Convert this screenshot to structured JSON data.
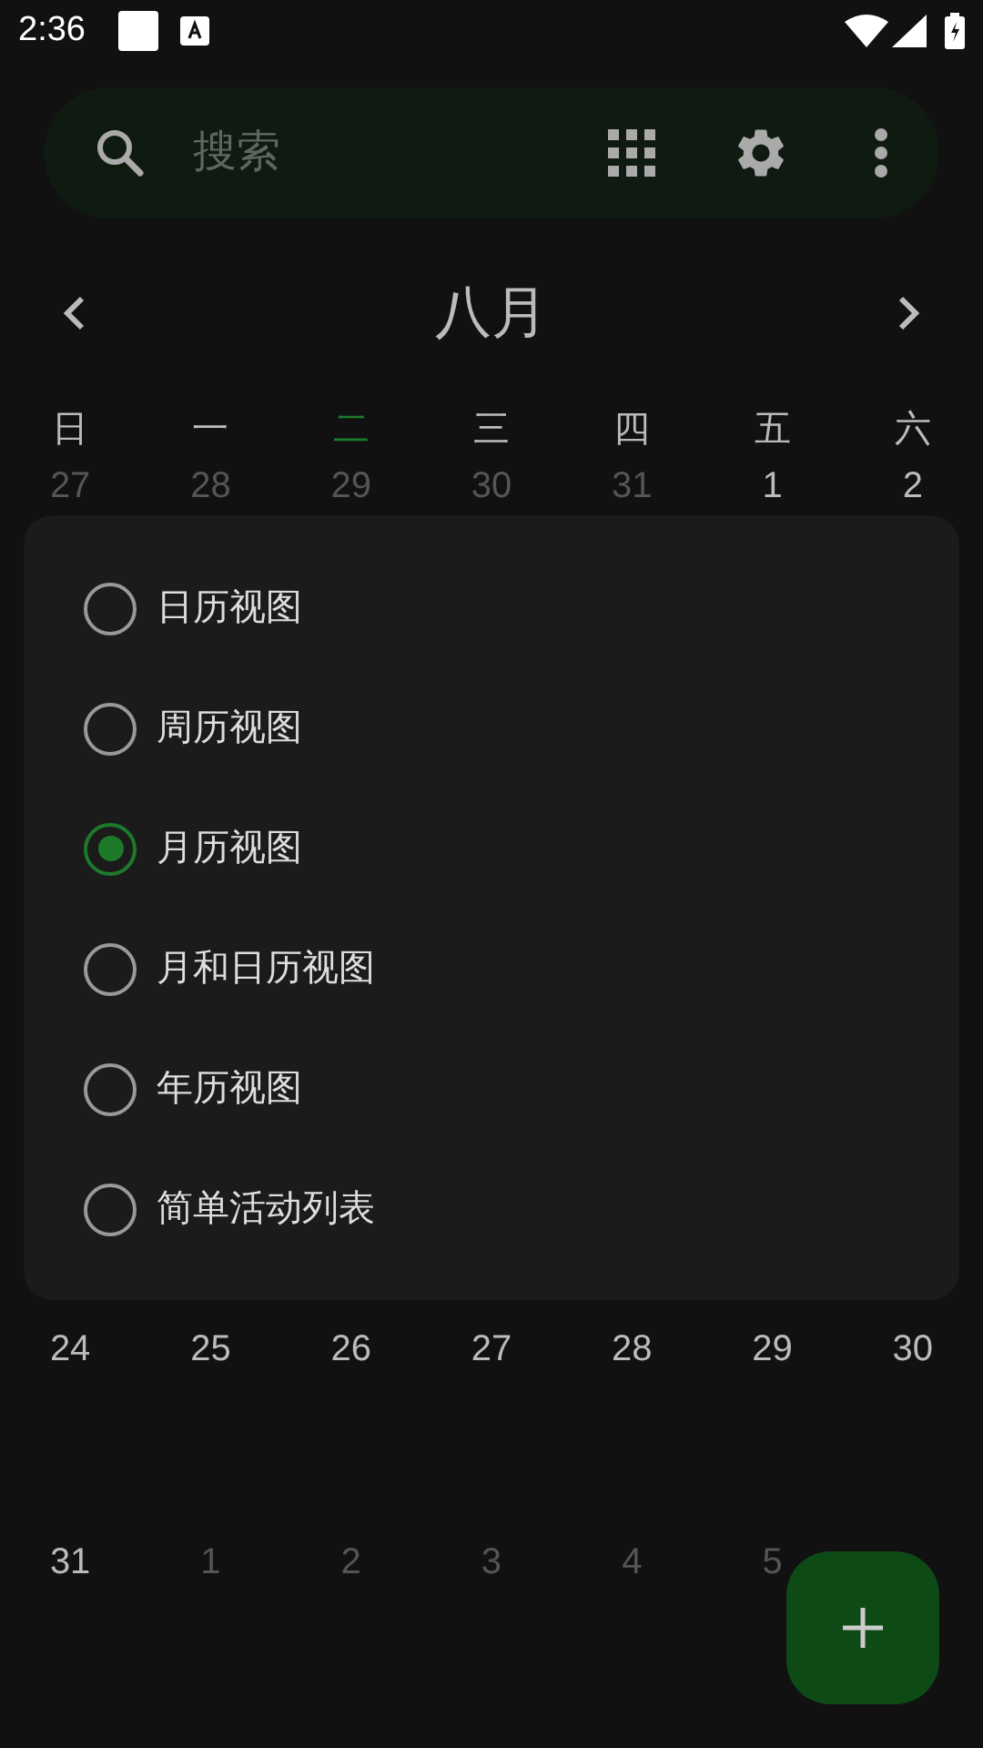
{
  "status_bar": {
    "time": "2:36"
  },
  "search": {
    "placeholder": "搜索"
  },
  "month": {
    "title": "八月"
  },
  "weekdays": [
    {
      "label": "日",
      "today": false
    },
    {
      "label": "一",
      "today": false
    },
    {
      "label": "二",
      "today": true
    },
    {
      "label": "三",
      "today": false
    },
    {
      "label": "四",
      "today": false
    },
    {
      "label": "五",
      "today": false
    },
    {
      "label": "六",
      "today": false
    }
  ],
  "first_week": [
    {
      "day": "27",
      "dim": true
    },
    {
      "day": "28",
      "dim": true
    },
    {
      "day": "29",
      "dim": true
    },
    {
      "day": "30",
      "dim": true
    },
    {
      "day": "31",
      "dim": true
    },
    {
      "day": "1",
      "dim": false
    },
    {
      "day": "2",
      "dim": false
    }
  ],
  "view_menu": [
    {
      "label": "日历视图",
      "selected": false
    },
    {
      "label": "周历视图",
      "selected": false
    },
    {
      "label": "月历视图",
      "selected": true
    },
    {
      "label": "月和日历视图",
      "selected": false
    },
    {
      "label": "年历视图",
      "selected": false
    },
    {
      "label": "简单活动列表",
      "selected": false
    }
  ],
  "later_weeks": [
    [
      {
        "day": "24",
        "dim": false
      },
      {
        "day": "25",
        "dim": false
      },
      {
        "day": "26",
        "dim": false
      },
      {
        "day": "27",
        "dim": false
      },
      {
        "day": "28",
        "dim": false
      },
      {
        "day": "29",
        "dim": false
      },
      {
        "day": "30",
        "dim": false
      }
    ],
    [
      {
        "day": "31",
        "dim": false
      },
      {
        "day": "1",
        "dim": true
      },
      {
        "day": "2",
        "dim": true
      },
      {
        "day": "3",
        "dim": true
      },
      {
        "day": "4",
        "dim": true
      },
      {
        "day": "5",
        "dim": true
      }
    ]
  ]
}
